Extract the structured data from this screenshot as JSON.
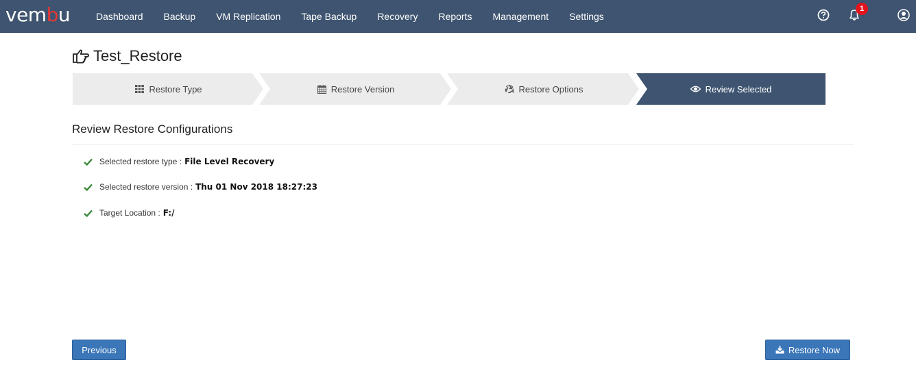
{
  "brand": {
    "logo_prefix": "vem",
    "logo_accent": "b",
    "logo_suffix": "u",
    "color_nav": "#3e5470",
    "color_accent": "#e53935"
  },
  "nav": {
    "items": [
      "Dashboard",
      "Backup",
      "VM Replication",
      "Tape Backup",
      "Recovery",
      "Reports",
      "Management",
      "Settings"
    ],
    "notification_count": "1",
    "icons": [
      "help-icon",
      "bell-icon",
      "user-icon"
    ]
  },
  "page": {
    "title": "Test_Restore",
    "title_icon": "hand-pointer-icon"
  },
  "wizard": {
    "steps": [
      {
        "label": "Restore Type",
        "icon": "grid-icon",
        "active": false
      },
      {
        "label": "Restore Version",
        "icon": "calendar-icon",
        "active": false
      },
      {
        "label": "Restore Options",
        "icon": "recycle-icon",
        "active": false
      },
      {
        "label": "Review Selected",
        "icon": "eye-icon",
        "active": true
      }
    ],
    "active_color": "#3e5470",
    "inactive_color": "#ececec"
  },
  "review": {
    "heading": "Review Restore Configurations",
    "items": [
      {
        "label": "Selected restore type :",
        "value": "File Level Recovery"
      },
      {
        "label": "Selected restore version :",
        "value": "Thu 01 Nov 2018 18:27:23"
      },
      {
        "label": "Target Location :",
        "value": "F:/"
      }
    ]
  },
  "actions": {
    "previous_label": "Previous",
    "restore_label": "Restore Now",
    "button_color": "#3a76b8"
  }
}
